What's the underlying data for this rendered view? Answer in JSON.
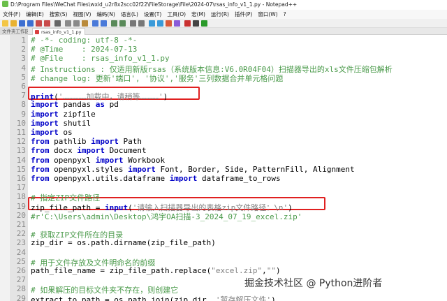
{
  "window": {
    "title": "D:\\Program Files\\WeChat Files\\wxid_u2r8x2scc02f22\\FileStorage\\File\\2024-07\\rsas_info_v1_1.py - Notepad++"
  },
  "menu": [
    "文件(F)",
    "编辑(E)",
    "搜索(S)",
    "视图(V)",
    "编码(N)",
    "语言(L)",
    "设置(T)",
    "工具(O)",
    "宏(M)",
    "运行(R)",
    "插件(P)",
    "窗口(W)",
    "?"
  ],
  "tabs": {
    "left_tab": "文件夹工作区",
    "active": "rsas_info_v1_1.py"
  },
  "code": [
    "# -*- coding: utf-8 -*-",
    "# @Time    : 2024-07-13",
    "# @File    : rsas_info_v1_1.py",
    "# Instructions : 仅适用新版rsas（系统版本信息:V6.0R04F04）扫描器导出的xls文件压缩包解析",
    "# change log: 更新'端口', '协议','服务'三列数据合并单元格问题",
    "",
    "print('……………加载中，请稍等…………')",
    "import pandas as pd",
    "import zipfile",
    "import shutil",
    "import os",
    "from pathlib import Path",
    "from docx import Document",
    "from openpyxl import Workbook",
    "from openpyxl.styles import Font, Border, Side, PatternFill, Alignment",
    "from openpyxl.utils.dataframe import dataframe_to_rows",
    "",
    "# 指定ZIP文件路径",
    "zip_file_path = input('请输入扫描器导出的表格zip文件路径：\\n')",
    "#r'C:\\Users\\admin\\Desktop\\鸿宇OA扫描-3_2024_07_19_excel.zip'",
    "",
    "# 获取ZIP文件所在的目录",
    "zip_dir = os.path.dirname(zip_file_path)",
    "",
    "# 用于文件存放及文件明命名的前缀",
    "path_file_name = zip_file_path.replace(\"excel.zip\",\"\")",
    "",
    "# 如果解压的目标文件夹不存在，则创建它",
    "extract_to_path = os.path.join(zip_dir, '暂存解压文件')"
  ],
  "watermark": "掘金技术社区 @ Python进阶者",
  "colors": {
    "comment": "#4a9a4a",
    "keyword": "#0000c8",
    "string": "#808080",
    "highlight_box": "#e02020"
  }
}
